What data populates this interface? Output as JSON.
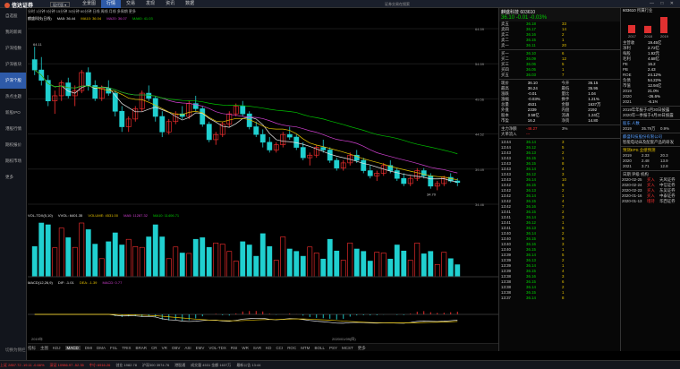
{
  "app": {
    "logo": "信达证券",
    "version": "现代版",
    "nav": [
      "全景图",
      "行情",
      "交易",
      "发现",
      "资讯",
      "数据"
    ],
    "nav_active": 1,
    "search_hint": "证券交易在搜索",
    "win": "— □ ✕"
  },
  "sidebar": {
    "items": [
      "自选股",
      "我的新闻",
      "沪深指数",
      "沪深板块",
      "沪深个股",
      "热点主题",
      "新股IPO",
      "港股行情",
      "期权报价",
      "期权市场",
      "更多"
    ],
    "active": 4,
    "bottom": "切换为侧栏"
  },
  "chart": {
    "period_tabs": "分时 1分钟 5分钟 15分钟 30分钟 60分钟 日线 周线 月线 多周期 更多",
    "stock_line": "麒盛科技(日线)",
    "ma_line": {
      "label": "MA5: 36.44",
      "ma10": "MA10: 36.04",
      "ma20": "MA20: 36.07",
      "ma60": "MA60: 41.03"
    },
    "hi_label": "64.11",
    "lo_label": "34.70",
    "vol_line": {
      "label": "VOL-TDX(5,10)",
      "vvol": "VVOL: 6401.35",
      "volume": "VOLUME: 4531.00",
      "ma5": "MA5: 11287.32",
      "ma10": "MA10: 11406.71"
    },
    "macd_line": {
      "label": "MACD(12,26,9)",
      "dif": "DIF: -1.01",
      "dea": "DEA: -1.39",
      "macd": "MACD: 0.77"
    },
    "date_label": "2020/01/09(四)",
    "year_label": "2019年",
    "y_ticks": [
      "64.59",
      "54.59",
      "49.56",
      "44.52",
      "39.49",
      "34.46"
    ],
    "candles": [
      [
        60,
        62.5,
        57,
        58
      ],
      [
        58,
        60.5,
        55,
        56
      ],
      [
        56,
        57,
        51,
        52
      ],
      [
        52,
        54,
        49.5,
        53
      ],
      [
        53,
        56,
        52,
        55.5
      ],
      [
        55.5,
        56.5,
        52.5,
        53
      ],
      [
        53,
        55,
        51,
        54
      ],
      [
        54,
        58,
        53.5,
        57.5
      ],
      [
        57.5,
        58.5,
        54,
        55
      ],
      [
        55,
        56,
        52,
        52.5
      ],
      [
        52.5,
        55,
        52,
        54.5
      ],
      [
        54.5,
        56,
        53,
        53.5
      ],
      [
        53.5,
        54,
        49,
        50
      ],
      [
        50,
        51,
        46,
        47
      ],
      [
        47,
        49,
        46,
        48.5
      ],
      [
        48.5,
        51,
        48,
        50.5
      ],
      [
        50.5,
        54,
        50,
        53.5
      ],
      [
        53.5,
        55,
        52,
        52.5
      ],
      [
        52.5,
        53,
        48,
        49
      ],
      [
        49,
        50,
        45,
        46
      ],
      [
        46,
        48.5,
        45.5,
        48
      ],
      [
        48,
        50,
        47.5,
        49.5
      ],
      [
        49.5,
        51,
        48.5,
        49
      ],
      [
        49,
        52,
        48.5,
        51.5
      ],
      [
        51.5,
        53,
        50,
        50.5
      ],
      [
        50.5,
        51,
        47,
        47.5
      ],
      [
        47.5,
        48,
        44,
        44.5
      ],
      [
        44.5,
        46,
        43.5,
        45.5
      ],
      [
        45.5,
        48,
        45,
        47.5
      ],
      [
        47.5,
        50,
        47,
        49.5
      ],
      [
        49.5,
        51.5,
        49,
        51
      ],
      [
        51,
        52,
        49,
        49.5
      ],
      [
        49.5,
        50,
        46.5,
        47
      ],
      [
        47,
        48,
        45,
        45.5
      ],
      [
        45.5,
        46.5,
        43,
        44
      ],
      [
        44,
        45,
        42,
        42.5
      ],
      [
        42.5,
        44,
        42,
        43.5
      ],
      [
        43.5,
        46,
        43,
        45.5
      ],
      [
        45.5,
        47,
        44.5,
        45
      ],
      [
        45,
        45.5,
        42.5,
        43
      ],
      [
        43,
        44,
        40.5,
        41
      ],
      [
        41,
        42,
        39.5,
        41.5
      ],
      [
        41.5,
        43.5,
        41,
        43
      ],
      [
        43,
        44.5,
        42,
        42.5
      ],
      [
        42.5,
        43,
        40,
        40.5
      ],
      [
        40.5,
        41,
        38.5,
        39
      ],
      [
        39,
        40.5,
        38.5,
        40
      ],
      [
        40,
        42,
        39.5,
        41.5
      ],
      [
        41.5,
        42.5,
        40,
        40.5
      ],
      [
        40.5,
        41,
        38,
        38.5
      ],
      [
        38.5,
        39.5,
        37,
        37.5
      ],
      [
        37.5,
        38.5,
        36.5,
        38
      ],
      [
        38,
        40,
        37.5,
        39.5
      ],
      [
        39.5,
        40.5,
        38,
        38.5
      ],
      [
        38.5,
        39,
        36.5,
        37
      ],
      [
        37,
        38,
        35.5,
        36
      ],
      [
        36,
        37.5,
        35.5,
        37
      ],
      [
        37,
        39,
        36.5,
        38.5
      ],
      [
        38.5,
        39,
        37,
        37.5
      ],
      [
        37.5,
        38,
        35,
        35.5
      ],
      [
        35.5,
        36.5,
        34.7,
        36
      ],
      [
        36,
        37.5,
        35.5,
        37.2
      ],
      [
        37.2,
        38,
        36.2,
        36.5
      ],
      [
        36.5,
        37,
        35.5,
        36.2
      ]
    ]
  },
  "quote": {
    "name": "麒盛科技 603610",
    "price": "36.10",
    "chg": "-0.01",
    "pct": "-0.03%",
    "asks": [
      [
        "卖五",
        "36.18",
        "33"
      ],
      [
        "卖四",
        "36.17",
        "14"
      ],
      [
        "卖三",
        "36.16",
        "2"
      ],
      [
        "卖二",
        "36.15",
        "1"
      ],
      [
        "卖一",
        "36.11",
        "20"
      ]
    ],
    "bids": [
      [
        "买一",
        "36.10",
        "6"
      ],
      [
        "买二",
        "36.09",
        "12"
      ],
      [
        "买三",
        "36.06",
        "5"
      ],
      [
        "买四",
        "36.05",
        "1"
      ],
      [
        "买五",
        "36.03",
        "7"
      ]
    ],
    "stats": [
      [
        "现价",
        "36.10",
        "今开",
        "36.15"
      ],
      [
        "最高",
        "36.24",
        "最低",
        "35.95"
      ],
      [
        "涨跌",
        "-0.01",
        "量比",
        "1.04"
      ],
      [
        "涨幅",
        "-0.03%",
        "换手",
        "1.21%"
      ],
      [
        "总量",
        "4531",
        "金额",
        "1637万"
      ],
      [
        "外盘",
        "2339",
        "内盘",
        "2192"
      ],
      [
        "股本",
        "3.58亿",
        "流通",
        "1.24亿"
      ],
      [
        "市盈",
        "16.2",
        "净资",
        "14.80"
      ]
    ],
    "flow": [
      [
        "主力净额",
        "-48.27",
        "3%"
      ],
      [
        "大单流入",
        "---",
        ""
      ]
    ],
    "ticks": [
      [
        "13:44",
        "36.14",
        "3"
      ],
      [
        "13:44",
        "36.12",
        "5"
      ],
      [
        "13:43",
        "36.13",
        "2"
      ],
      [
        "13:43",
        "36.15",
        "1"
      ],
      [
        "13:43",
        "36.15",
        "8"
      ],
      [
        "13:43",
        "36.14",
        "4"
      ],
      [
        "13:43",
        "36.12",
        "3"
      ],
      [
        "13:43",
        "36.14",
        "10"
      ],
      [
        "13:42",
        "36.15",
        "6"
      ],
      [
        "13:42",
        "36.13",
        "2"
      ],
      [
        "13:42",
        "36.14",
        "1"
      ],
      [
        "13:42",
        "36.15",
        "4"
      ],
      [
        "13:42",
        "36.16",
        "7"
      ],
      [
        "13:41",
        "36.15",
        "2"
      ],
      [
        "13:41",
        "36.14",
        "3"
      ],
      [
        "13:41",
        "36.12",
        "1"
      ],
      [
        "13:41",
        "36.13",
        "6"
      ],
      [
        "13:40",
        "36.14",
        "2"
      ],
      [
        "13:40",
        "36.15",
        "9"
      ],
      [
        "13:40",
        "36.16",
        "3"
      ],
      [
        "13:40",
        "36.15",
        "1"
      ],
      [
        "13:39",
        "36.14",
        "5"
      ],
      [
        "13:39",
        "36.13",
        "2"
      ],
      [
        "13:39",
        "36.14",
        "1"
      ],
      [
        "13:39",
        "36.15",
        "4"
      ],
      [
        "13:38",
        "36.16",
        "3"
      ],
      [
        "13:38",
        "36.15",
        "6"
      ],
      [
        "13:38",
        "36.14",
        "2"
      ],
      [
        "13:38",
        "36.15",
        "1"
      ],
      [
        "13:37",
        "36.14",
        "8"
      ]
    ]
  },
  "farpanel": {
    "code": "603610",
    "title": "所属行业",
    "years": [
      "2017",
      "2018",
      "2019"
    ],
    "bars": [
      0.5,
      0.45,
      1.0
    ],
    "rows": [
      [
        "主营收",
        "19.45亿"
      ],
      [
        "净利",
        "2.72亿"
      ],
      [
        "每股",
        "1.92元"
      ],
      [
        "毛利",
        "4.68亿"
      ],
      [
        "PE",
        "16.2"
      ],
      [
        "PB",
        "2.43"
      ],
      [
        "ROE",
        "24.12%"
      ],
      [
        "负债",
        "54.22%"
      ],
      [
        "市值",
        "12.94亿"
      ],
      [
        "2019",
        "21.0%"
      ],
      [
        "2020",
        "-26.6%"
      ],
      [
        "2021",
        "-6.1%"
      ]
    ],
    "notes": [
      "2019年年报于4月30日披露",
      "2020年一季报于4月30日披露"
    ],
    "holders_hdr": "股东 人数",
    "holders": [
      [
        "2019",
        "35.79万",
        "0.9%"
      ]
    ],
    "company": "麒盛科技股份有限公司",
    "biz": "智能电动床及配套产品的研发",
    "forecast_hdr": "预测EPS 业绩预测",
    "forecast": [
      [
        "2019",
        "2.33",
        "20.3"
      ],
      [
        "2020",
        "2.48",
        "13.9"
      ],
      [
        "2021",
        "3.71",
        "12.8"
      ]
    ],
    "rating_hdr": "日期 评级 机构",
    "ratings": [
      [
        "2020-02-25",
        "买入",
        "天风证券"
      ],
      [
        "2020-02-24",
        "买入",
        "中信证券"
      ],
      [
        "2020-02-23",
        "买入",
        "东吴证券"
      ],
      [
        "2020-01-16",
        "买入",
        "中泰证券"
      ],
      [
        "2020-01-13",
        "增持",
        "华西证券"
      ]
    ]
  },
  "tabs": [
    "指标",
    "主图",
    "KDJ",
    "MACD",
    "DMI",
    "DMA",
    "FSL",
    "TRIX",
    "BRAR",
    "CR",
    "VR",
    "OBV",
    "ASI",
    "EMV",
    "VOL-TDX",
    "RSI",
    "WR",
    "SAR",
    "KD",
    "CCI",
    "ROC",
    "MTM",
    "BOLL",
    "PSY",
    "MCST",
    "更多"
  ],
  "tabs_active": 3,
  "status": [
    "上证 2857.72 -19.11 -0.66%",
    "深证 10986.97 -52.35",
    "中小 6916.26",
    "创业 1982.78",
    "沪深300 3974.76",
    "港股通",
    "成交量 4531 金额 1637万",
    "最新公告 13:44"
  ]
}
